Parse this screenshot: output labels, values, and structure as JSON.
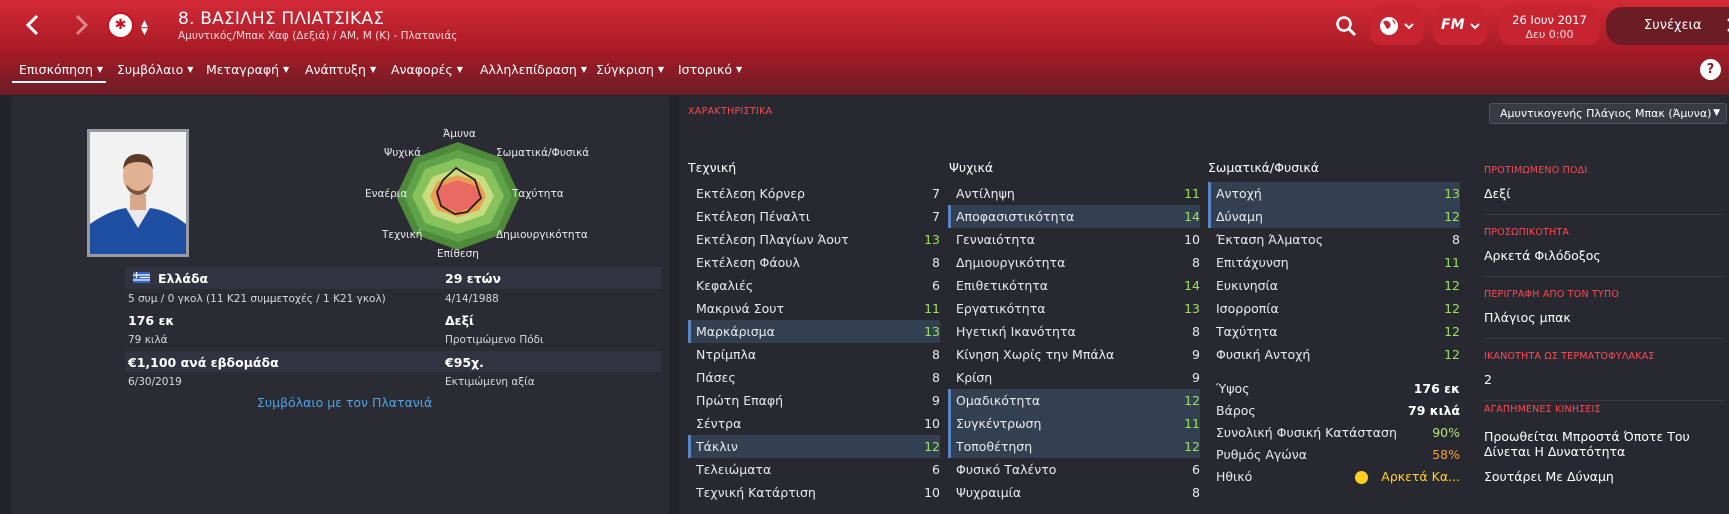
{
  "header": {
    "player_name": "8. ΒΑΣΙΛΗΣ ΠΛΙΑΤΣΙΚΑΣ",
    "player_role": "Αμυντικός/Μπακ Χαφ (Δεξιά) / ΑΜ, Μ (Κ) - Πλατανιάς",
    "back_icon": "chevron-left-icon",
    "forward_icon": "chevron-right-icon",
    "date": "26 Ιουν 2017",
    "time": "Δευ 0:00",
    "continue_label": "Συνέχεια",
    "fm_label": "FM",
    "accent": "#c8202e"
  },
  "tabs": [
    {
      "label": "Επισκόπηση"
    },
    {
      "label": "Συμβόλαιο"
    },
    {
      "label": "Μεταγραφή"
    },
    {
      "label": "Ανάπτυξη"
    },
    {
      "label": "Αναφορές"
    },
    {
      "label": "Αλληλεπίδραση"
    },
    {
      "label": "Σύγκριση"
    },
    {
      "label": "Ιστορικό"
    }
  ],
  "help_label": "?",
  "overview": {
    "radar_labels": {
      "top": "Άμυνα",
      "top_right": "Σωματικά/Φυσικά",
      "right": "Ταχύτητα",
      "bottom_right": "Δημιουργικότητα",
      "bottom": "Επίθεση",
      "bottom_left": "Τεχνική",
      "left": "Εναέρια",
      "top_left": "Ψυχικά"
    },
    "nationality": "Ελλάδα",
    "caps": "5 συμ / 0 γκολ (11 Κ21 συμμετοχές / 1 Κ21 γκολ)",
    "age": "29 ετών",
    "birth_date": "4/14/1988",
    "height": "176 εκ",
    "weight": "79 κιλά",
    "preferred_foot": "Δεξί",
    "preferred_foot_label": "Προτιμώμενο Πόδι",
    "wage": "€1,100 ανά εβδομάδα",
    "contract_end": "6/30/2019",
    "value": "€95χ.",
    "value_label": "Εκτιμώμενη αξία",
    "contract_link": "Συμβόλαιο με τον Πλατανιά"
  },
  "attributes": {
    "title": "ΧΑΡΑΚΤΗΡΙΣΤΙΚΑ",
    "role_selector": "Αμυντικογενής Πλάγιος Μπακ (Άμυνα)",
    "technical_header": "Τεχνική",
    "mental_header": "Ψυχικά",
    "physical_header": "Σωματικά/Φυσικά",
    "technical": [
      {
        "name": "Εκτέλεση Κόρνερ",
        "value": "7",
        "hl": false,
        "green": false
      },
      {
        "name": "Εκτέλεση Πέναλτι",
        "value": "7",
        "hl": false,
        "green": false
      },
      {
        "name": "Εκτέλεση Πλαγίων Άουτ",
        "value": "13",
        "hl": false,
        "green": true
      },
      {
        "name": "Εκτέλεση Φάουλ",
        "value": "8",
        "hl": false,
        "green": false
      },
      {
        "name": "Κεφαλιές",
        "value": "6",
        "hl": false,
        "green": false
      },
      {
        "name": "Μακρινά Σουτ",
        "value": "11",
        "hl": false,
        "green": true
      },
      {
        "name": "Μαρκάρισμα",
        "value": "13",
        "hl": true,
        "green": true
      },
      {
        "name": "Ντρίμπλα",
        "value": "8",
        "hl": false,
        "green": false
      },
      {
        "name": "Πάσες",
        "value": "8",
        "hl": false,
        "green": false
      },
      {
        "name": "Πρώτη Επαφή",
        "value": "9",
        "hl": false,
        "green": false
      },
      {
        "name": "Σέντρα",
        "value": "10",
        "hl": false,
        "green": false
      },
      {
        "name": "Τάκλιν",
        "value": "12",
        "hl": true,
        "green": true
      },
      {
        "name": "Τελειώματα",
        "value": "6",
        "hl": false,
        "green": false
      },
      {
        "name": "Τεχνική Κατάρτιση",
        "value": "10",
        "hl": false,
        "green": false
      }
    ],
    "mental": [
      {
        "name": "Αντίληψη",
        "value": "11",
        "hl": false,
        "green": true
      },
      {
        "name": "Αποφασιστικότητα",
        "value": "14",
        "hl": true,
        "green": true
      },
      {
        "name": "Γενναιότητα",
        "value": "10",
        "hl": false,
        "green": false
      },
      {
        "name": "Δημιουργικότητα",
        "value": "8",
        "hl": false,
        "green": false
      },
      {
        "name": "Επιθετικότητα",
        "value": "14",
        "hl": false,
        "green": true
      },
      {
        "name": "Εργατικότητα",
        "value": "13",
        "hl": false,
        "green": true
      },
      {
        "name": "Ηγετική Ικανότητα",
        "value": "8",
        "hl": false,
        "green": false
      },
      {
        "name": "Κίνηση Χωρίς την Μπάλα",
        "value": "9",
        "hl": false,
        "green": false
      },
      {
        "name": "Κρίση",
        "value": "9",
        "hl": false,
        "green": false
      },
      {
        "name": "Ομαδικότητα",
        "value": "12",
        "hl": true,
        "green": true
      },
      {
        "name": "Συγκέντρωση",
        "value": "11",
        "hl": true,
        "green": true
      },
      {
        "name": "Τοποθέτηση",
        "value": "12",
        "hl": true,
        "green": true
      },
      {
        "name": "Φυσικό Ταλέντο",
        "value": "6",
        "hl": false,
        "green": false
      },
      {
        "name": "Ψυχραιμία",
        "value": "8",
        "hl": false,
        "green": false
      }
    ],
    "physical": [
      {
        "name": "Αντοχή",
        "value": "13",
        "hl": true,
        "green": true
      },
      {
        "name": "Δύναμη",
        "value": "12",
        "hl": true,
        "green": true
      },
      {
        "name": "Έκταση Άλματος",
        "value": "8",
        "hl": false,
        "green": false
      },
      {
        "name": "Επιτάχυνση",
        "value": "11",
        "hl": false,
        "green": true
      },
      {
        "name": "Ευκινησία",
        "value": "12",
        "hl": false,
        "green": true
      },
      {
        "name": "Ισορροπία",
        "value": "12",
        "hl": false,
        "green": true
      },
      {
        "name": "Ταχύτητα",
        "value": "12",
        "hl": false,
        "green": true
      },
      {
        "name": "Φυσική Αντοχή",
        "value": "12",
        "hl": false,
        "green": true
      }
    ],
    "stats": [
      {
        "name": "Ύψος",
        "value": "176 εκ",
        "color": "#ffffff"
      },
      {
        "name": "Βάρος",
        "value": "79 κιλά",
        "color": "#ffffff"
      },
      {
        "name": "Συνολική Φυσική Κατάσταση",
        "value": "90%",
        "color": "#b9e07a"
      },
      {
        "name": "Ρυθμός Αγώνα",
        "value": "58%",
        "color": "#f0a040"
      },
      {
        "name": "Ηθικό",
        "value": "Αρκετά Κα...",
        "color": "#ffd020"
      }
    ]
  },
  "player_info": {
    "foot_label": "ΠΡΟΤΙΜΩΜΕΝΟ ΠΟΔΙ",
    "foot_value": "Δεξί",
    "personality_label": "ΠΡΟΣΩΠΙΚΟΤΗΤΑ",
    "personality_value": "Αρκετά Φιλόδοξος",
    "media_label": "ΠΕΡΙΓΡΑΦΗ ΑΠΟ ΤΟΝ ΤΥΠΟ",
    "media_value": "Πλάγιος μπακ",
    "gk_label": "ΙΚΑΝΟΤΗΤΑ ΩΣ ΤΕΡΜΑΤΟΦΥΛΑΚΑΣ",
    "gk_value": "2",
    "moves_label": "ΑΓΑΠΗΜΕΝΕΣ ΚΙΝΗΣΕΙΣ",
    "moves": [
      "Προωθείται Μπροστά Όποτε Του Δίνεται Η Δυνατότητα",
      "Σουτάρει Με Δύναμη"
    ]
  }
}
